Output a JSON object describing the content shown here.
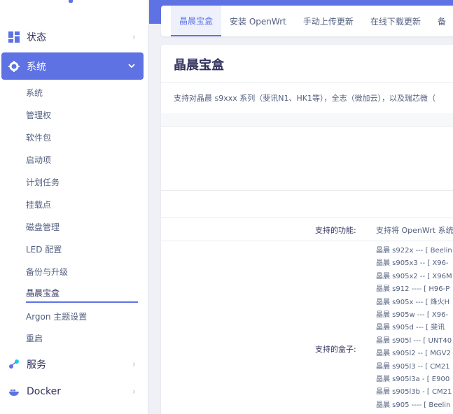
{
  "sidebar": {
    "top_item": {
      "label": "状态",
      "icon": "dashboard-icon"
    },
    "active_item": {
      "label": "系统",
      "icon": "gear-icon"
    },
    "sub_items": [
      {
        "label": "系统"
      },
      {
        "label": "管理权"
      },
      {
        "label": "软件包"
      },
      {
        "label": "启动项"
      },
      {
        "label": "计划任务"
      },
      {
        "label": "挂载点"
      },
      {
        "label": "磁盘管理"
      },
      {
        "label": "LED 配置"
      },
      {
        "label": "备份与升级"
      },
      {
        "label": "晶晨宝盒"
      },
      {
        "label": "Argon 主题设置"
      },
      {
        "label": "重启"
      }
    ],
    "bottom_items": [
      {
        "label": "服务",
        "icon": "services-icon"
      },
      {
        "label": "Docker",
        "icon": "docker-icon"
      }
    ],
    "chevron_right": "›",
    "chevron_down": "⌄"
  },
  "tabs": [
    {
      "label": "晶晨宝盒"
    },
    {
      "label": "安装 OpenWrt"
    },
    {
      "label": "手动上传更新"
    },
    {
      "label": "在线下载更新"
    },
    {
      "label": "备"
    }
  ],
  "main": {
    "title": "晶晨宝盒",
    "description": "支持对晶晨 s9xxx 系列（斐讯N1、HK1等），全志（微加云），以及瑞芯微（",
    "features_label": "支持的功能:",
    "features_value": "支持将 OpenWrt 系统",
    "boxes_label": "支持的盒子:",
    "boxes": [
      "晶晨 s922x --- [ Beelin",
      "晶晨 s905x3 -- [ X96-",
      "晶晨 s905x2 -- [ X96M",
      "晶晨 s912 ---- [ H96-P",
      "晶晨 s905x --- [ 烽火H",
      "晶晨 s905w --- [ X96-",
      "晶晨 s905d --- [ 斐讯",
      "晶晨 s905l --- [ UNT40",
      "晶晨 s905l2 -- [ MGV2",
      "晶晨 s905l3 -- [ CM21",
      "晶晨 s905l3a - [ E900",
      "晶晨 s905l3b - [ CM21",
      "晶晨 s905 ---- [ Beelin"
    ]
  },
  "colors": {
    "accent": "#5e72e4",
    "sidebar_bg": "#ffffff",
    "page_bg": "#f0f1f6"
  }
}
